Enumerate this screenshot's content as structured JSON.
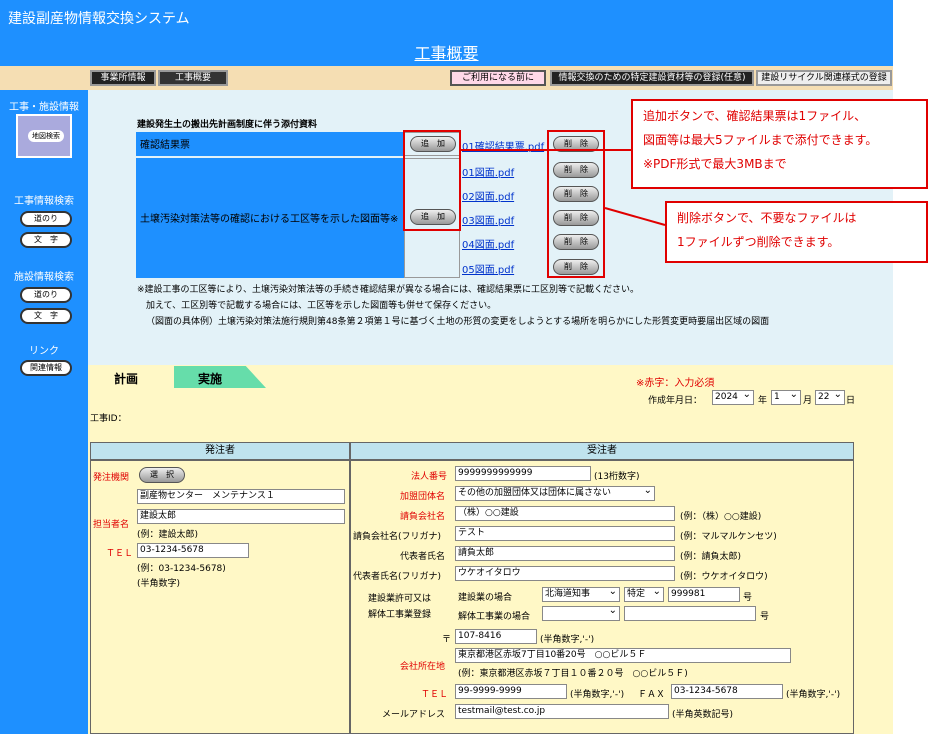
{
  "header": {
    "system_title": "建設副産物情報交換システム",
    "page_title": "工事概要"
  },
  "nav": {
    "tab_office": "事業所情報",
    "tab_overview": "工事概要",
    "before_use": "ご利用になる前に",
    "register_materials": "情報交換のための特定建設資材等の登録(任意)",
    "register_recycle": "建設リサイクル関連様式の登録"
  },
  "sidebar": {
    "section1": "工事・施設情報",
    "map_search": "地図検索",
    "section2": "工事情報検索",
    "road": "道のり",
    "text": "文　字",
    "section3": "施設情報検索",
    "road2": "道のり",
    "text2": "文　字",
    "link_h": "リンク",
    "related": "関連情報"
  },
  "attach": {
    "title": "建設発生土の搬出先計画制度に伴う添付資料",
    "row1_label": "確認結果票",
    "row2_label": "土壌汚染対策法等の確認における工区等を示した図面等※",
    "add": "追　加",
    "delete": "削　除",
    "file1": "01確認結果票.pdf",
    "files": [
      "01図面.pdf",
      "02図面.pdf",
      "03図面.pdf",
      "04図面.pdf",
      "05図面.pdf"
    ]
  },
  "notes": [
    "※建設工事の工区等により、土壌汚染対策法等の手続き確認結果が異なる場合には、確認結果票に工区別等で記載ください。",
    "加えて、工区別等で記載する場合には、工区等を示した図面等も併せて保存ください。",
    "（図面の具体例）土壌汚染対策法施行規則第48条第２項第１号に基づく土地の形質の変更をしようとする場所を明らかにした形質変更時要届出区域の図面"
  ],
  "callouts": {
    "top": [
      "追加ボタンで、確認結果票は1ファイル、",
      "図面等は最大5ファイルまで添付できます。",
      "※PDF形式で最大3MBまで"
    ],
    "right": [
      "削除ボタンで、不要なファイルは",
      "1ファイルずつ削除できます。"
    ]
  },
  "form": {
    "tab_plan": "計画",
    "tab_exec": "実施",
    "required": "※赤字：入力必須",
    "created_label": "作成年月日：",
    "year": "2024",
    "year_u": "年",
    "month": "1",
    "month_u": "月",
    "day": "22",
    "day_u": "日",
    "koji_id": "工事ID：",
    "orderer": {
      "head": "発注者",
      "org_label": "発注機関",
      "select_btn": "選　択",
      "org_value": "副産物センター　メンテナンス１",
      "person_label": "担当者名",
      "person_value": "建設太郎",
      "person_ex": "(例：建設太郎)",
      "tel_label": "ＴＥＬ",
      "tel_value": "03-1234-5678",
      "tel_ex": "(例：03-1234-5678)",
      "tel_note": "(半角数字)"
    },
    "contractor": {
      "head": "受注者",
      "corp_no_label": "法人番号",
      "corp_no": "9999999999999",
      "corp_no_note": "(13桁数字)",
      "assoc_label": "加盟団体名",
      "assoc_value": "その他の加盟団体又は団体に属さない",
      "company_label": "請負会社名",
      "company_value": "（株）○○建設",
      "company_ex": "(例：（株）○○建設)",
      "kana_label": "請負会社名(フリガナ)",
      "kana_value": "テスト",
      "kana_ex": "(例：マルマルケンセツ)",
      "rep_label": "代表者氏名",
      "rep_value": "請負太郎",
      "rep_ex": "(例：請負太郎)",
      "rep_kana_label": "代表者氏名(フリガナ)",
      "rep_kana_value": "ウケオイタロウ",
      "rep_kana_ex": "(例：ウケオイタロウ)",
      "license_label1": "建設業許可又は",
      "license_label2": "解体工事業登録",
      "license_case1": "建設業の場合",
      "license_sel1": "北海道知事",
      "license_sel2": "特定",
      "license_no": "999981",
      "license_no_u": "号",
      "license_case2": "解体工事業の場合",
      "license_no_u2": "号",
      "zip_mark": "〒",
      "zip": "107-8416",
      "zip_note": "(半角数字,'-')",
      "addr_label": "会社所在地",
      "addr_value": "東京都港区赤坂7丁目10番20号　○○ビル５Ｆ",
      "addr_ex": "(例：東京都港区赤坂７丁目１０番２０号　○○ビル５Ｆ)",
      "tel_label": "ＴＥＬ",
      "tel_value": "99-9999-9999",
      "tel_note": "(半角数字,'-')",
      "fax_label": "ＦＡＸ",
      "fax_value": "03-1234-5678",
      "fax_note": "(半角数字,'-')",
      "mail_label": "メールアドレス",
      "mail_value": "testmail@test.co.jp",
      "mail_note": "(半角英数記号)"
    }
  }
}
